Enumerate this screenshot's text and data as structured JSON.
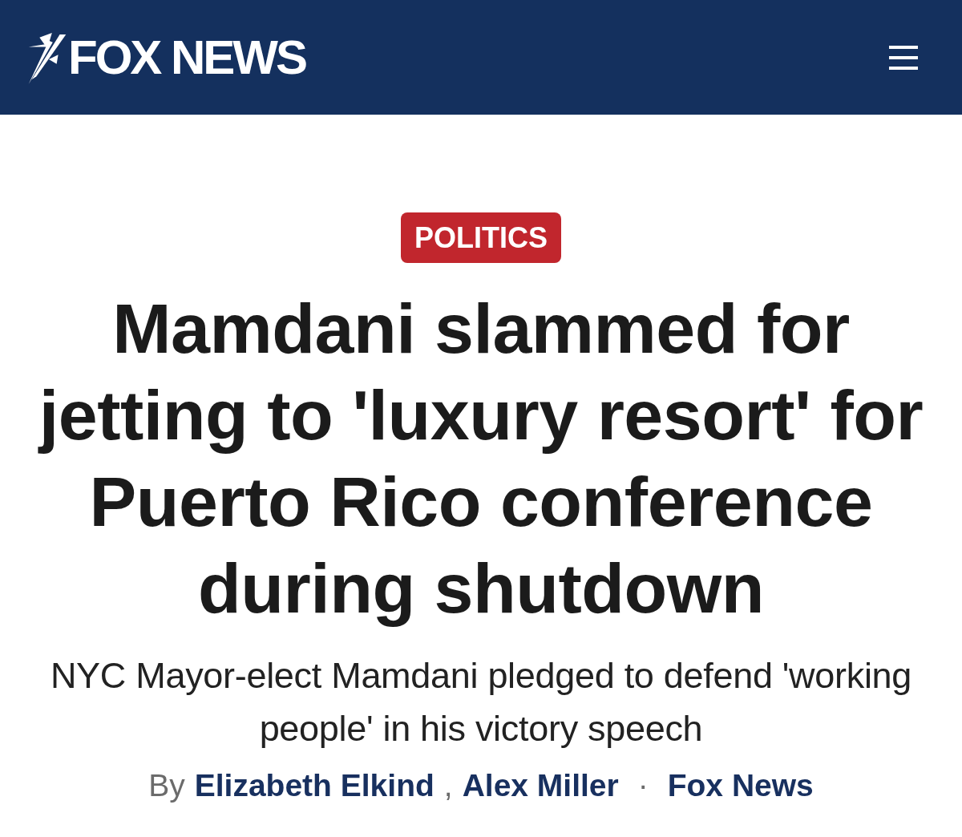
{
  "header": {
    "logo_text": "FOX NEWS"
  },
  "category": {
    "label": "POLITICS"
  },
  "headline": "Mamdani slammed for jetting to 'luxury resort' for Puerto Rico conference during shutdown",
  "subheadline": "NYC Mayor-elect Mamdani pledged to defend 'working people' in his victory speech",
  "byline": {
    "prefix": "By",
    "authors": [
      "Elizabeth Elkind",
      "Alex Miller"
    ],
    "author_separator": ",",
    "dot": "·",
    "source": "Fox News"
  }
}
